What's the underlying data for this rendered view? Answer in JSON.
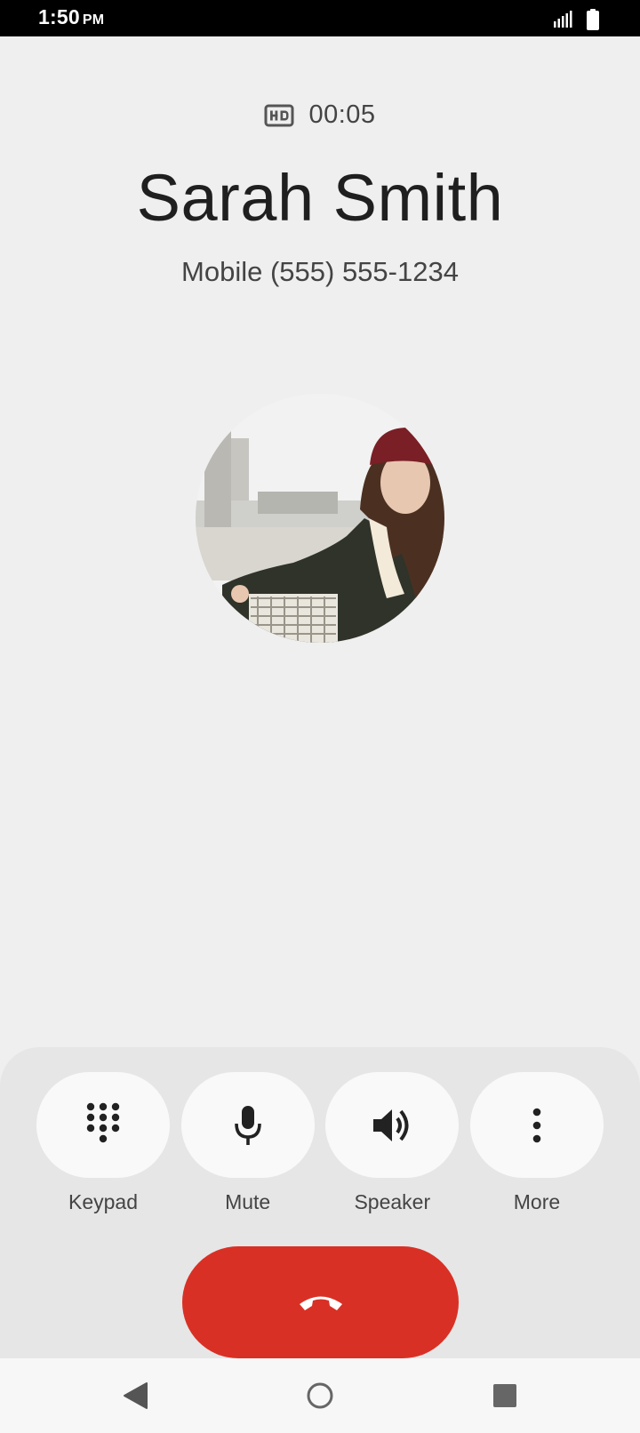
{
  "status_bar": {
    "time": "1:50",
    "ampm": "PM",
    "icons": [
      "signal-icon",
      "battery-icon"
    ]
  },
  "call": {
    "hd_icon": "hd-icon",
    "timer": "00:05",
    "contact_name": "Sarah Smith",
    "contact_number": "Mobile (555) 555-1234"
  },
  "actions": [
    {
      "label": "Keypad",
      "icon": "dialpad-icon"
    },
    {
      "label": "Mute",
      "icon": "microphone-icon"
    },
    {
      "label": "Speaker",
      "icon": "speaker-icon"
    },
    {
      "label": "More",
      "icon": "more-vert-icon"
    }
  ],
  "end_call": {
    "icon": "end-call-icon",
    "color": "#d93025"
  },
  "nav_bar": {
    "icons": [
      "back-icon",
      "home-icon",
      "recents-icon"
    ]
  }
}
